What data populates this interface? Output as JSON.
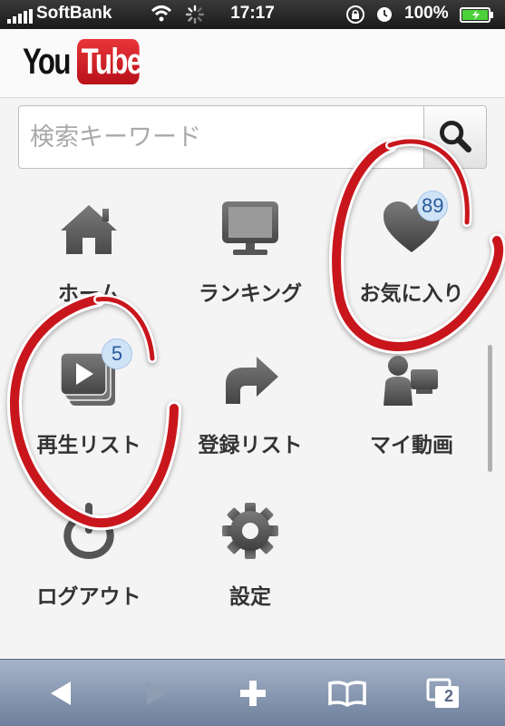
{
  "status_bar": {
    "carrier": "SoftBank",
    "time": "17:17",
    "battery_percent": "100%",
    "signal_bars": 5
  },
  "header": {
    "logo_you": "You",
    "logo_tube": "Tube",
    "brand_color": "#d0202a"
  },
  "search": {
    "placeholder": "検索キーワード",
    "button_icon": "search-icon"
  },
  "menu": {
    "home": {
      "label": "ホーム",
      "icon": "home-icon"
    },
    "ranking": {
      "label": "ランキング",
      "icon": "monitor-icon"
    },
    "favorites": {
      "label": "お気に入り",
      "icon": "heart-icon",
      "badge": "89"
    },
    "playlists": {
      "label": "再生リスト",
      "icon": "playlist-icon",
      "badge": "5"
    },
    "subscriptions": {
      "label": "登録リスト",
      "icon": "share-arrow-icon"
    },
    "my_videos": {
      "label": "マイ動画",
      "icon": "user-camera-icon"
    },
    "logout": {
      "label": "ログアウト",
      "icon": "power-icon"
    },
    "settings": {
      "label": "設定",
      "icon": "gear-icon"
    }
  },
  "toolbar": {
    "back_icon": "back-arrow-icon",
    "forward_icon": "forward-arrow-icon",
    "add_icon": "plus-icon",
    "bookmarks_icon": "book-icon",
    "pages_icon": "pages-icon",
    "pages_count": "2"
  },
  "colors": {
    "annotation_red": "#c8161c",
    "icon_gray": "#5a5a5a",
    "badge_bg": "#cfe3f7"
  }
}
